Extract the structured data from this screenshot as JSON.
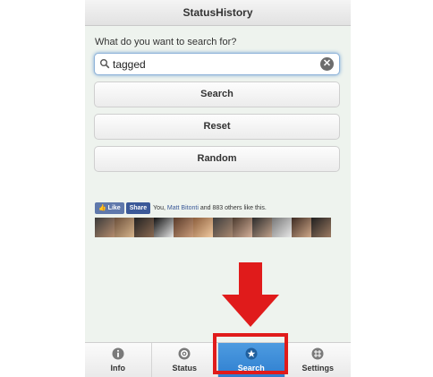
{
  "app": {
    "title": "StatusHistory"
  },
  "search": {
    "prompt": "What do you want to search for?",
    "value": "tagged"
  },
  "buttons": {
    "search": "Search",
    "reset": "Reset",
    "random": "Random"
  },
  "facebook": {
    "like_label": "Like",
    "share_label": "Share",
    "social_prefix": "You,",
    "social_name": "Matt Bitonti",
    "social_suffix": "and 883 others like this."
  },
  "tabs": [
    {
      "label": "Info",
      "icon": "info-icon"
    },
    {
      "label": "Status",
      "icon": "gear-icon"
    },
    {
      "label": "Search",
      "icon": "star-icon",
      "active": true
    },
    {
      "label": "Settings",
      "icon": "grid-icon"
    }
  ],
  "colors": {
    "accent": "#2f7fd0",
    "annotation": "#e01b1b",
    "facebook": "#3b5998"
  }
}
